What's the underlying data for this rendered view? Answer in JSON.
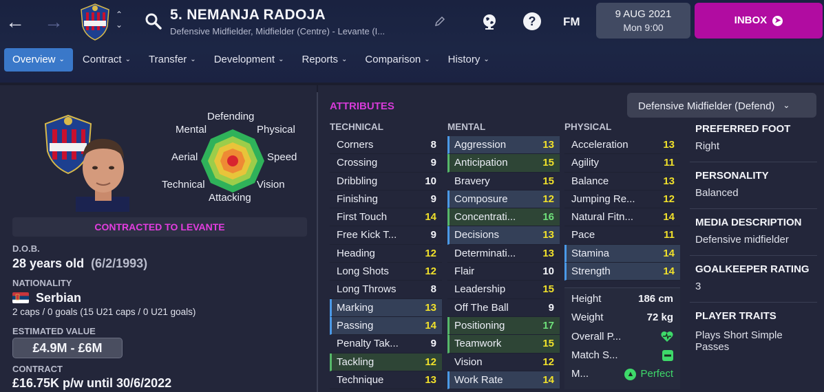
{
  "header": {
    "player_name": "5. NEMANJA RADOJA",
    "subtitle": "Defensive Midfielder, Midfielder (Centre) - Levante (I...",
    "fm_label": "FM",
    "date": "9 AUG 2021",
    "time": "Mon 9:00",
    "inbox_label": "INBOX",
    "help_label": "?"
  },
  "tabs": [
    {
      "label": "Overview",
      "active": true
    },
    {
      "label": "Contract"
    },
    {
      "label": "Transfer"
    },
    {
      "label": "Development"
    },
    {
      "label": "Reports"
    },
    {
      "label": "Comparison"
    },
    {
      "label": "History"
    }
  ],
  "radar_labels": {
    "defending": "Defending",
    "mental": "Mental",
    "physical": "Physical",
    "aerial": "Aerial",
    "speed": "Speed",
    "technical": "Technical",
    "vision": "Vision",
    "attacking": "Attacking"
  },
  "profile": {
    "contract_banner": "CONTRACTED TO LEVANTE",
    "dob_label": "D.O.B.",
    "age": "28 years old",
    "dob": "(6/2/1993)",
    "nationality_label": "NATIONALITY",
    "nationality": "Serbian",
    "caps": "2 caps / 0 goals (15 U21 caps / 0 U21 goals)",
    "value_label": "ESTIMATED VALUE",
    "value": "£4.9M - £6M",
    "contract_label": "CONTRACT",
    "contract": "£16.75K p/w until 30/6/2022"
  },
  "attributes": {
    "title": "ATTRIBUTES",
    "role": "Defensive Midfielder (Defend)",
    "technical_label": "TECHNICAL",
    "mental_label": "MENTAL",
    "physical_label": "PHYSICAL",
    "technical": [
      {
        "name": "Corners",
        "value": "8"
      },
      {
        "name": "Crossing",
        "value": "9"
      },
      {
        "name": "Dribbling",
        "value": "10"
      },
      {
        "name": "Finishing",
        "value": "9"
      },
      {
        "name": "First Touch",
        "value": "14"
      },
      {
        "name": "Free Kick T...",
        "value": "9"
      },
      {
        "name": "Heading",
        "value": "12"
      },
      {
        "name": "Long Shots",
        "value": "12"
      },
      {
        "name": "Long Throws",
        "value": "8"
      },
      {
        "name": "Marking",
        "value": "13",
        "hl": "key"
      },
      {
        "name": "Passing",
        "value": "14",
        "hl": "key"
      },
      {
        "name": "Penalty Tak...",
        "value": "9"
      },
      {
        "name": "Tackling",
        "value": "12",
        "hl": "pref"
      },
      {
        "name": "Technique",
        "value": "13"
      }
    ],
    "mental": [
      {
        "name": "Aggression",
        "value": "13",
        "hl": "key"
      },
      {
        "name": "Anticipation",
        "value": "15",
        "hl": "pref"
      },
      {
        "name": "Bravery",
        "value": "15"
      },
      {
        "name": "Composure",
        "value": "12",
        "hl": "key"
      },
      {
        "name": "Concentrati...",
        "value": "16",
        "hl": "pref"
      },
      {
        "name": "Decisions",
        "value": "13",
        "hl": "key"
      },
      {
        "name": "Determinati...",
        "value": "13"
      },
      {
        "name": "Flair",
        "value": "10"
      },
      {
        "name": "Leadership",
        "value": "15"
      },
      {
        "name": "Off The Ball",
        "value": "9"
      },
      {
        "name": "Positioning",
        "value": "17",
        "hl": "pref"
      },
      {
        "name": "Teamwork",
        "value": "15",
        "hl": "pref"
      },
      {
        "name": "Vision",
        "value": "12"
      },
      {
        "name": "Work Rate",
        "value": "14",
        "hl": "key"
      }
    ],
    "physical": [
      {
        "name": "Acceleration",
        "value": "13"
      },
      {
        "name": "Agility",
        "value": "11"
      },
      {
        "name": "Balance",
        "value": "13"
      },
      {
        "name": "Jumping Re...",
        "value": "12"
      },
      {
        "name": "Natural Fitn...",
        "value": "14"
      },
      {
        "name": "Pace",
        "value": "11"
      },
      {
        "name": "Stamina",
        "value": "14",
        "hl": "key"
      },
      {
        "name": "Strength",
        "value": "14",
        "hl": "key"
      }
    ],
    "physical_info": {
      "height_label": "Height",
      "height": "186 cm",
      "weight_label": "Weight",
      "weight": "72 kg",
      "overall_label": "Overall P...",
      "match_label": "Match S...",
      "m_label": "M...",
      "m_value": "Perfect"
    }
  },
  "info": {
    "foot_label": "PREFERRED FOOT",
    "foot": "Right",
    "personality_label": "PERSONALITY",
    "personality": "Balanced",
    "media_label": "MEDIA DESCRIPTION",
    "media": "Defensive midfielder",
    "gk_label": "GOALKEEPER RATING",
    "gk": "3",
    "traits_label": "PLAYER TRAITS",
    "traits_line1": "Plays Short Simple",
    "traits_line2": "Passes"
  },
  "colors": {
    "accent": "#b10ca1",
    "tab_active": "#3a78c9",
    "value_yellow": "#f1e12b",
    "value_green": "#6ee07a",
    "value_white": "#f4f5fa"
  }
}
